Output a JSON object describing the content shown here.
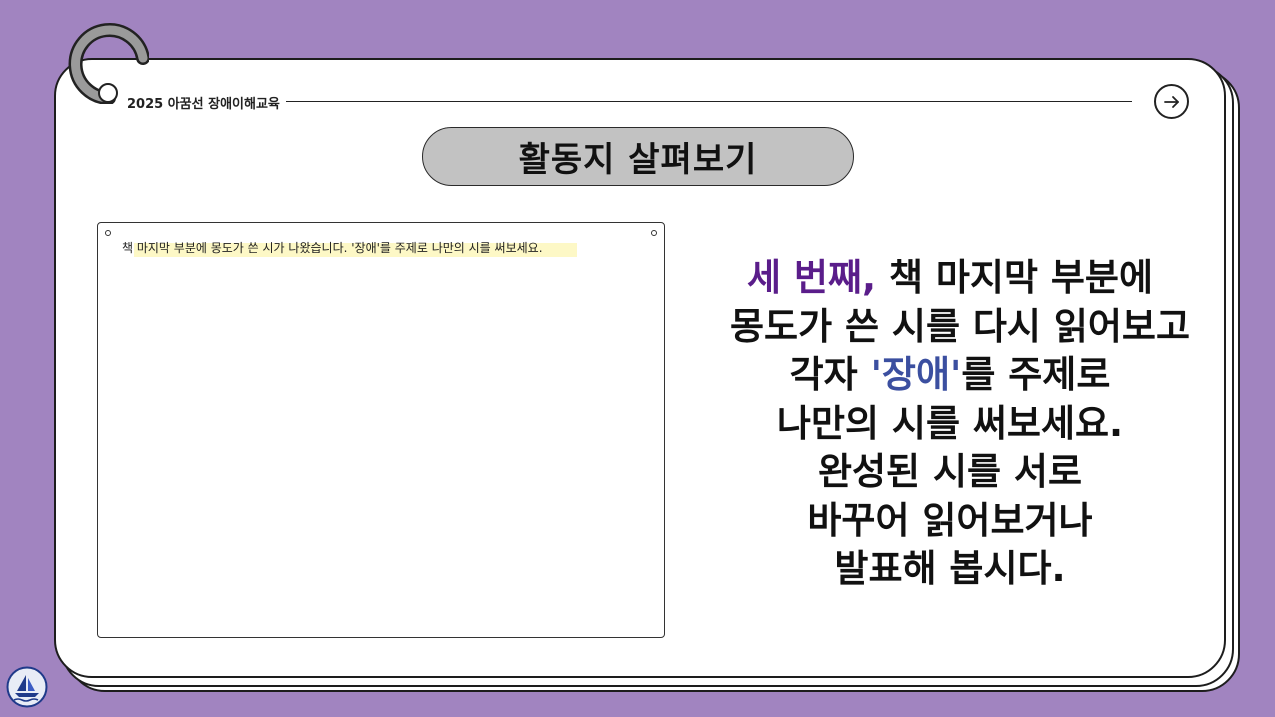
{
  "header": {
    "label": "2025 아꿈선 장애이해교육"
  },
  "title": "활동지 살펴보기",
  "worksheet": {
    "prompt": "책 마지막 부분에 몽도가 쓴 시가 나왔습니다. '장애'를 주제로 나만의 시를 써보세요."
  },
  "instructions": {
    "line1_accent": "세 번째,",
    "line1_rest": " 책 마지막 부분에",
    "line2": "몽도가 쓴 시를 다시 읽어보고",
    "line3_pre": "각자 ",
    "line3_accent": "'장애'",
    "line3_post": "를 주제로",
    "line4": "나만의 시를 써보세요.",
    "line5": "완성된 시를 서로",
    "line6": "바꾸어 읽어보거나",
    "line7": "발표해 봅시다."
  },
  "colors": {
    "background": "#a184c0",
    "accent_purple": "#5a1d8a",
    "accent_blue": "#3b4fa0",
    "title_pill": "#c2c2c2",
    "highlight": "#fdf8c6"
  },
  "icons": {
    "ring": "binder-ring-icon",
    "next": "arrow-right-icon",
    "logo": "sailboat-logo-icon"
  }
}
